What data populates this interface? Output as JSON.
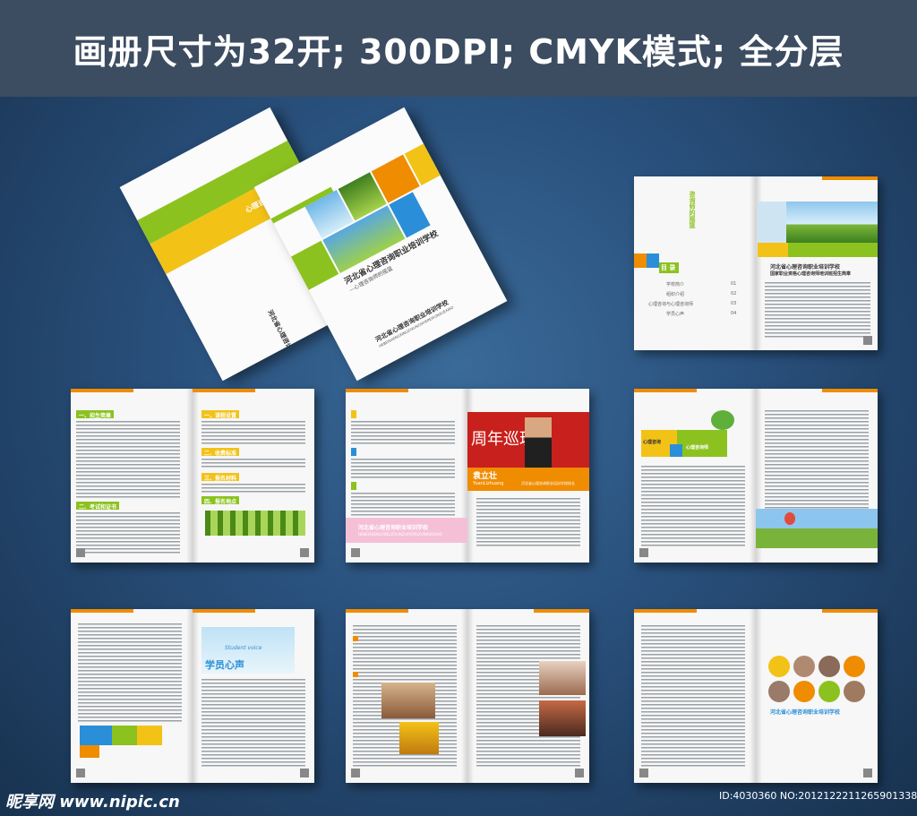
{
  "banner": {
    "title": "画册尺寸为32开; 300DPI; CMYK模式; 全分层"
  },
  "cover_back": {
    "tag": "心理咨询师",
    "school": "河北省心理咨询职业培训学校"
  },
  "cover_front": {
    "title": "河北省心理咨询职业培训学校",
    "subtitle": "—心理咨询师的摇篮",
    "school": "河北省心理咨询职业培训学校",
    "school_en": "HEBEISHENGXINLIZIXUNZHIYEPEIXUNXUEXIAO"
  },
  "spread_toc": {
    "vertical_title": "咨询师的摇篮",
    "toc_label": "目 录",
    "toc_items": [
      {
        "label": "学校简介",
        "page": "01"
      },
      {
        "label": "组织介绍",
        "page": "02"
      },
      {
        "label": "心理咨询与心理咨询师",
        "page": "03"
      },
      {
        "label": "学员心声",
        "page": "04"
      }
    ],
    "heading1": "河北省心理咨询职业培训学校",
    "heading2": "国家职业资格心理咨询师培训班招生简章"
  },
  "spread_intro": {
    "h1": "一、招生简章",
    "h2": "二、考试和证书",
    "h3": "一、课程设置",
    "h4": "二、收费标准",
    "h5": "三、报名材料",
    "h6": "四、报名地点"
  },
  "spread_profile": {
    "banner": "周年巡理学",
    "name": "袁立壮",
    "name_en": "YuanLizhuang",
    "caption": "河北省心理咨询职业培训学校校长",
    "pink_title": "河北省心理咨询职业培训学校",
    "pink_en": "HEBEISHENGXINLIZIXUNZHIYEPEIXUNXUEXIAO"
  },
  "spread_counsel": {
    "label_left": "心理咨询",
    "label_right": "心理咨询师"
  },
  "spread_voice": {
    "en": "Student voice",
    "cn": "学员心声"
  },
  "spread_photos": {
    "school": "河北省心理咨询职业培训学校"
  },
  "footer": {
    "left": "昵享网 www.nipic.cn",
    "right": "ID:4030360 NO:20121222112659013386"
  },
  "colors": {
    "green": "#8cc21f",
    "yellow": "#f3c217",
    "orange": "#f08c00",
    "blue": "#2a8fd8",
    "pink": "#e9559b"
  }
}
